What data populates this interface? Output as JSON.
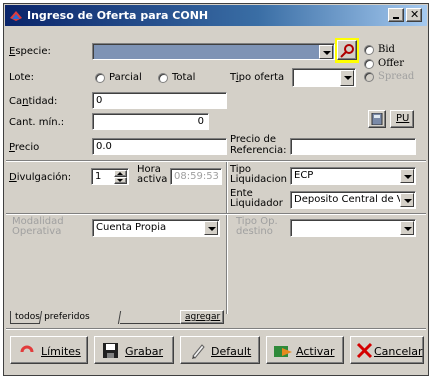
{
  "window": {
    "title": "Ingreso de Oferta para CONH"
  },
  "colors": {
    "title_start": "#0a246a",
    "highlight": "#ffff00",
    "especie_fill": "#7e93b5"
  },
  "especie": {
    "label": "Especie:",
    "value": ""
  },
  "side_options": {
    "bid": "Bid",
    "offer": "Offer",
    "spread": "Spread"
  },
  "lote": {
    "label": "Lote:",
    "parcial": "Parcial",
    "total": "Total"
  },
  "tipo_oferta": {
    "label": "Tipo oferta",
    "value": ""
  },
  "cantidad": {
    "label": "Cantidad:",
    "value": "0"
  },
  "cant_min": {
    "label": "Cant. mín.:",
    "value": "0"
  },
  "pu_button": "PU",
  "precio": {
    "label": "Precio",
    "value": "0.0"
  },
  "precio_ref": {
    "label_1": "Precio de",
    "label_2": "Referencia:",
    "value": ""
  },
  "divulgacion": {
    "label": "Divulgación:",
    "value": "1"
  },
  "hora_activa": {
    "label_1": "Hora",
    "label_2": "activa",
    "value": "08:59:53"
  },
  "tipo_liquidacion": {
    "label_1": "Tipo",
    "label_2": "Liquidacion",
    "value": "ECP"
  },
  "ente_liquidador": {
    "label_1": "Ente",
    "label_2": "Liquidador",
    "value": "Deposito Central de V"
  },
  "modalidad_operativa": {
    "label_1": "Modalidad",
    "label_2": "Operativa",
    "value": "Cuenta Propia"
  },
  "tipo_op_destino": {
    "label_1": "Tipo Op.",
    "label_2": "destino",
    "value": ""
  },
  "tabs": {
    "todos": "todos",
    "preferidos": "preferidos",
    "agregar": "agregar"
  },
  "buttons": {
    "limites": "Límites",
    "grabar": "Grabar",
    "default": "Default",
    "activar": "Activar",
    "cancelar": "Cancelar"
  }
}
